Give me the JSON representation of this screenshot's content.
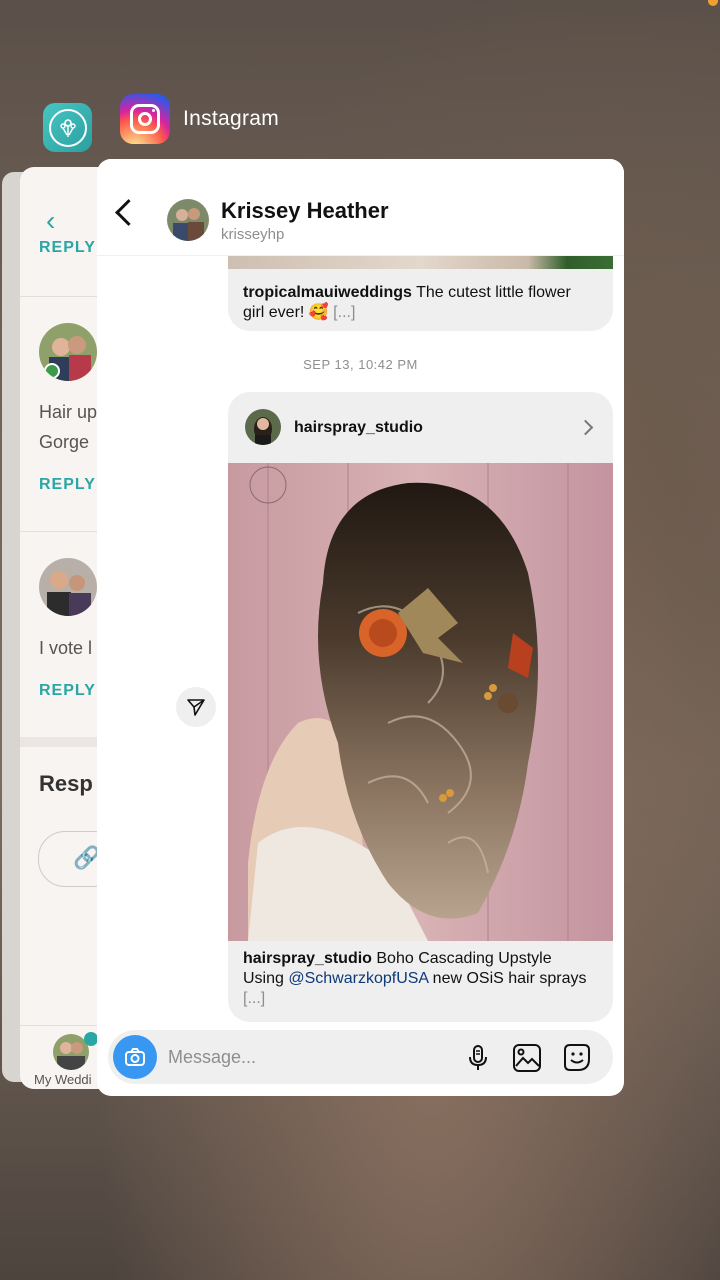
{
  "switcher": {
    "app_name": "Instagram"
  },
  "wedding_app": {
    "reply_label": "REPLY",
    "comment1_text_line1": "Hair up",
    "comment1_text_line2": "Gorge",
    "comment2_text": "I vote l",
    "responses_heading": "Resp",
    "tab_label": "My Weddi"
  },
  "instagram": {
    "header": {
      "name": "Krissey Heather",
      "handle": "krisseyhp"
    },
    "prev_post": {
      "username": "tropicalmauiweddings",
      "caption": " The cutest little flower girl ever! 🥰 ",
      "more": "[...]"
    },
    "timestamp": "SEP 13, 10:42 PM",
    "shared_post": {
      "username": "hairspray_studio",
      "caption_user": "hairspray_studio",
      "caption_pre": " Boho Cascading Upstyle Using ",
      "mention": "@SchwarzkopfUSA",
      "caption_post": " new OSiS hair sprays ",
      "more": "[...]"
    },
    "composer": {
      "placeholder": "Message..."
    }
  },
  "colors": {
    "wedding_accent": "#2aa6a4",
    "ig_blue": "#3897f0",
    "bubble_bg": "#efefef"
  },
  "icons": [
    "wedding-app-icon",
    "instagram-app-icon",
    "back-chevron-icon",
    "chevron-right-icon",
    "send-icon",
    "camera-icon",
    "microphone-icon",
    "gallery-icon",
    "sticker-icon",
    "link-icon"
  ]
}
